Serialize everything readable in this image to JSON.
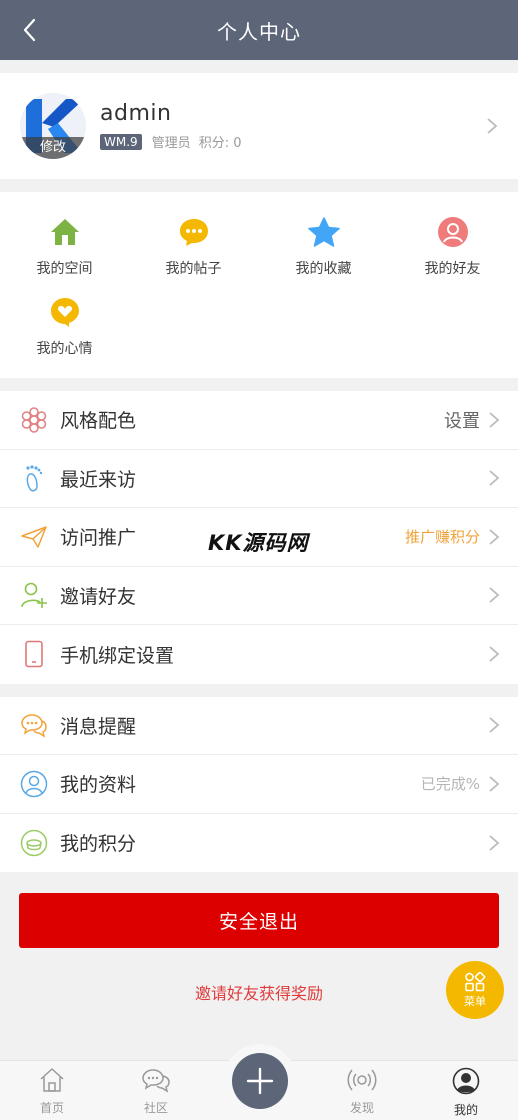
{
  "header": {
    "title": "个人中心",
    "back_icon": "back-arrow-icon"
  },
  "profile": {
    "name": "admin",
    "edit_label": "修改",
    "badge": "WM.9",
    "role": "管理员",
    "points": "积分: 0"
  },
  "shortcuts": [
    {
      "label": "我的空间",
      "icon": "home-icon",
      "color": "#7cb342"
    },
    {
      "label": "我的帖子",
      "icon": "chat-bubble-icon",
      "color": "#f5b800"
    },
    {
      "label": "我的收藏",
      "icon": "star-icon",
      "color": "#42a5f5"
    },
    {
      "label": "我的好友",
      "icon": "friend-icon",
      "color": "#ef7b7b"
    },
    {
      "label": "我的心情",
      "icon": "heart-bubble-icon",
      "color": "#f5b800"
    }
  ],
  "settings_group1": [
    {
      "label": "风格配色",
      "right": "设置",
      "icon": "flower-icon"
    },
    {
      "label": "最近来访",
      "right": "",
      "icon": "footprint-icon"
    },
    {
      "label": "访问推广",
      "right": "推广赚积分",
      "icon": "paper-plane-icon"
    },
    {
      "label": "邀请好友",
      "right": "",
      "icon": "add-user-icon"
    },
    {
      "label": "手机绑定设置",
      "right": "",
      "icon": "phone-icon"
    }
  ],
  "settings_group2": [
    {
      "label": "消息提醒",
      "right": "",
      "icon": "message-icon"
    },
    {
      "label": "我的资料",
      "right": "已完成%",
      "icon": "user-profile-icon"
    },
    {
      "label": "我的积分",
      "right": "",
      "icon": "points-icon"
    }
  ],
  "watermark": "KK源码网",
  "logout_label": "安全退出",
  "invite_text": "邀请好友获得奖励",
  "fab_label": "菜单",
  "tabbar": [
    {
      "label": "首页",
      "icon": "home-outline-icon"
    },
    {
      "label": "社区",
      "icon": "community-icon"
    },
    {
      "label": "",
      "icon": "plus-icon"
    },
    {
      "label": "发现",
      "icon": "discover-icon"
    },
    {
      "label": "我的",
      "icon": "user-icon"
    }
  ],
  "colors": {
    "header": "#5c6678",
    "logout": "#dd0000",
    "fab": "#f5b800"
  }
}
